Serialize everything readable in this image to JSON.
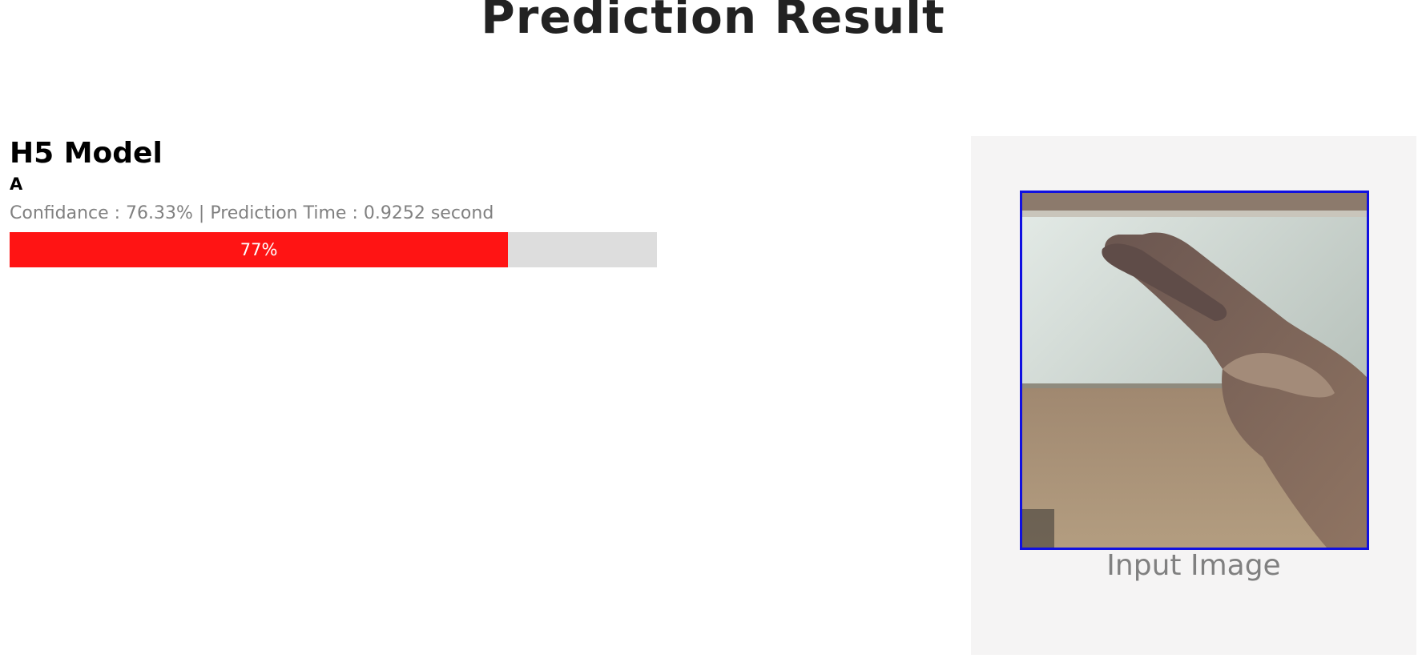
{
  "page": {
    "title": "Prediction Result"
  },
  "result": {
    "model_name": "H5 Model",
    "predicted_label": "A",
    "stats_text": "Confidance : 76.33% | Prediction Time : 0.9252 second",
    "progress": {
      "percent": 77,
      "label": "77%",
      "fill_color": "#ff1414",
      "track_color": "#dddddd"
    }
  },
  "input_image": {
    "caption": "Input Image",
    "border_color": "#1010e0",
    "alt": "hand gesture"
  }
}
